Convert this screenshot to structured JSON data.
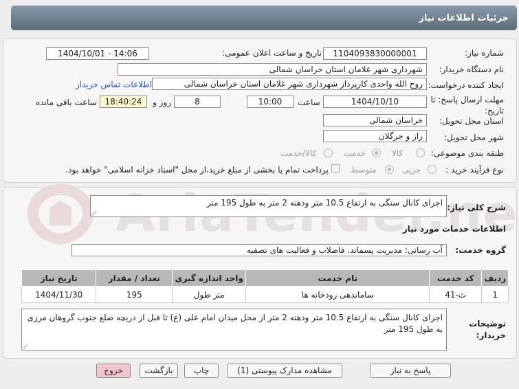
{
  "window": {
    "title": "جزئیات اطلاعات نیاز"
  },
  "watermark": {
    "text": "AriaTender.net"
  },
  "info": {
    "need_number_label": "شماره نیاز:",
    "need_number": "1104093830000001",
    "announce_label": "تاریخ و ساعت اعلان عمومی:",
    "announce_value": "1404/10/01 - 14:06",
    "buyer_org_label": "نام دستگاه خریدار:",
    "buyer_org": "شهرداری شهر غلامان استان خراسان شمالی",
    "requester_label": "ایجاد کننده درخواست:",
    "requester": "روح الله  واحدی کارپرداز شهرداری شهر غلامان استان خراسان شمالی",
    "contact_link": "اطلاعات تماس خریدار",
    "deadline_label": "مهلت ارسال پاسخ: تا تاریخ:",
    "deadline_date": "1404/10/10",
    "time_label": "ساعت",
    "deadline_time": "10:00",
    "days_value": "8",
    "days_label": "روز و",
    "remaining_time": "18:40:24",
    "remaining_label": "ساعت باقی مانده",
    "province_label": "استان محل تحویل:",
    "province": "خراسان شمالی",
    "city_label": "شهر محل تحویل:",
    "city": "راز و جرگلان",
    "category_label": "طبقه بندی موضوعی:",
    "category_options": [
      "کالا",
      "خدمت",
      "کالا/خدمت"
    ],
    "category_selected": "خدمت",
    "process_label": "نوع فرآیند خرید :",
    "process_options": [
      "جزیی",
      "متوسط"
    ],
    "process_selected": "متوسط",
    "payment_note": "پرداخت تمام یا بخشی از مبلغ خرید،از محل \"اسناد خزانه اسلامی\" خواهد بود."
  },
  "summary": {
    "label": "شرح کلی نیاز:",
    "text": "اجرای کانال سنگی به ارتفاع 10.5 متر ودهنه 2 متر به طول 195 متر"
  },
  "services": {
    "section_title": "اطلاعات خدمات مورد نیاز",
    "group_label": "گروه خدمت:",
    "group_value": "آب رسانی؛ مدیریت پسماند، فاضلاب و فعالیت های تصفیه",
    "columns": [
      "ردیف",
      "کد خدمت",
      "نام خدمت",
      "واحد اندازه گیری",
      "تعداد / مقدار",
      "تاریخ نیاز"
    ],
    "rows": [
      [
        "1",
        "ث-41",
        "ساماندهی رودخانه ها",
        "متر طول",
        "195",
        "1404/11/30"
      ]
    ]
  },
  "buyer_notes": {
    "label": "توضیحات خریدار:",
    "text": "اجرای کانال سنگی به ارتفاع 10.5 متر ودهنه 2 متر از محل میدان امام علی (ع) تا قبل از دریچه ضلع جنوب گروهان مرزی به طول 195 متر"
  },
  "buttons": {
    "reply": "پاسخ به نیاز",
    "attachments": "مشاهده مدارک پیوستی (1)",
    "print": "چاپ",
    "back": "بازگشت",
    "exit": "خروج"
  },
  "colors": {
    "title_bar": "#6d7d8c",
    "link": "#1a55d8",
    "table_header": "#b8b8b8",
    "exit_button": "#f2c6cc",
    "remaining_time_bg": "#fffbd0"
  }
}
